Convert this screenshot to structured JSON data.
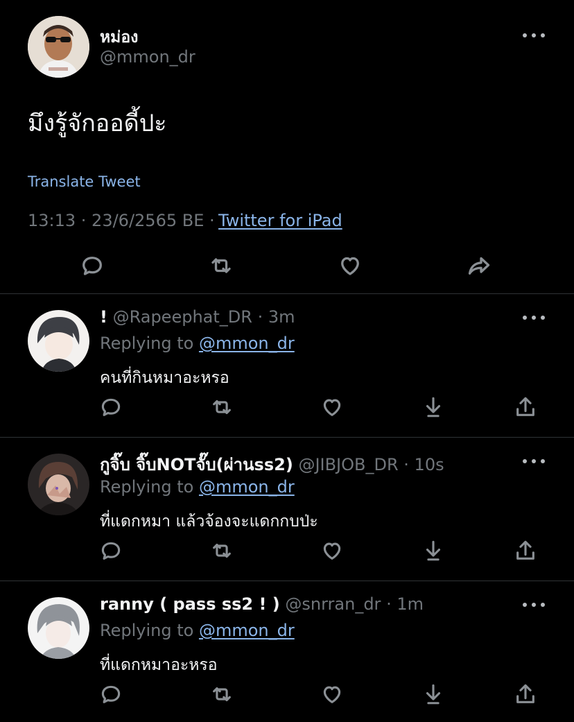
{
  "tweet": {
    "display_name": "หม่อง",
    "handle": "@mmon_dr",
    "text": "มึงรู้จักออดี้ปะ",
    "translate_label": "Translate Tweet",
    "timestamp": "13:13 · 23/6/2565 BE ·",
    "source": "Twitter for iPad"
  },
  "replies": [
    {
      "display_name": "!",
      "handle": "@Rapeephat_DR",
      "time": "· 3m",
      "replying_label": "Replying to",
      "replying_to": "@mmon_dr",
      "text": "คนที่กินหมาอะหรอ"
    },
    {
      "display_name": "กูจิ๊บ จิ๊บNOTจั๊บ(ผ่านss2)",
      "handle": "@JIBJOB_DR",
      "time": "· 10s",
      "replying_label": "Replying to",
      "replying_to": "@mmon_dr",
      "text": "ที่แดกหมา แล้วจ้องจะแดกกบป่ะ"
    },
    {
      "display_name": "ranny ( pass ss2 ! )",
      "handle": "@snrran_dr",
      "time": "· 1m",
      "replying_label": "Replying to",
      "replying_to": "@mmon_dr",
      "text": "ที่แดกหมาอะหรอ"
    }
  ],
  "colors": {
    "background": "#000000",
    "link": "#8ab4e8",
    "secondary_text": "#71767b",
    "divider": "#2f3336"
  }
}
